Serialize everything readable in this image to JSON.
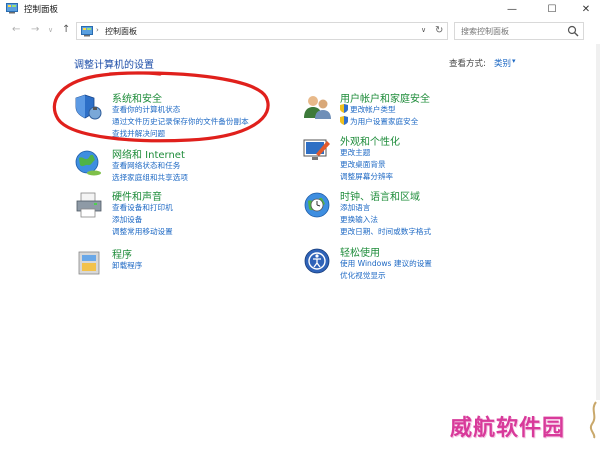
{
  "window": {
    "title": "控制面板",
    "controls": {
      "minimize": "—",
      "maximize": "☐",
      "close": "✕"
    }
  },
  "address_bar": {
    "back": "←",
    "forward": "→",
    "dropdown": "∨",
    "up": "↑",
    "crumb_sep": "›",
    "path": "控制面板",
    "refresh": "↻",
    "search_placeholder": "搜索控制面板"
  },
  "header": {
    "title": "调整计算机的设置",
    "view_by_label": "查看方式:",
    "view_by_value": "类别",
    "view_by_arrow": "▾"
  },
  "categories": [
    {
      "id": "system",
      "title": "系统和安全",
      "icon": "system-security-shield-icon",
      "links": [
        {
          "text": "查看你的计算机状态",
          "shield": false
        },
        {
          "text": "通过文件历史记录保存你的文件备份副本",
          "shield": false
        },
        {
          "text": "查找并解决问题",
          "shield": false
        }
      ]
    },
    {
      "id": "network",
      "title": "网络和 Internet",
      "icon": "network-globe-icon",
      "links": [
        {
          "text": "查看网络状态和任务",
          "shield": false
        },
        {
          "text": "选择家庭组和共享选项",
          "shield": false
        }
      ]
    },
    {
      "id": "hardware",
      "title": "硬件和声音",
      "icon": "printer-icon",
      "links": [
        {
          "text": "查看设备和打印机",
          "shield": false
        },
        {
          "text": "添加设备",
          "shield": false
        },
        {
          "text": "调整常用移动设置",
          "shield": false
        }
      ]
    },
    {
      "id": "programs",
      "title": "程序",
      "icon": "programs-icon",
      "links": [
        {
          "text": "卸载程序",
          "shield": false
        }
      ]
    },
    {
      "id": "users",
      "title": "用户帐户和家庭安全",
      "icon": "users-icon",
      "links": [
        {
          "text": "更改帐户类型",
          "shield": true
        },
        {
          "text": "为用户设置家庭安全",
          "shield": true
        }
      ]
    },
    {
      "id": "appearance",
      "title": "外观和个性化",
      "icon": "appearance-monitor-icon",
      "links": [
        {
          "text": "更改主题",
          "shield": false
        },
        {
          "text": "更改桌面背景",
          "shield": false
        },
        {
          "text": "调整屏幕分辨率",
          "shield": false
        }
      ]
    },
    {
      "id": "clock",
      "title": "时钟、语言和区域",
      "icon": "clock-globe-icon",
      "links": [
        {
          "text": "添加语言",
          "shield": false
        },
        {
          "text": "更换输入法",
          "shield": false
        },
        {
          "text": "更改日期、时间或数字格式",
          "shield": false
        }
      ]
    },
    {
      "id": "ease",
      "title": "轻松使用",
      "icon": "ease-of-access-icon",
      "links": [
        {
          "text": "使用 Windows 建议的设置",
          "shield": false
        },
        {
          "text": "优化视觉显示",
          "shield": false
        }
      ]
    }
  ],
  "watermark": {
    "text": "威航软件园"
  },
  "colors": {
    "category_title": "#1e8c3a",
    "link": "#1e69c4",
    "heading": "#1e4ea8",
    "annotation": "#e0201c",
    "watermark": "#d83a9a"
  }
}
